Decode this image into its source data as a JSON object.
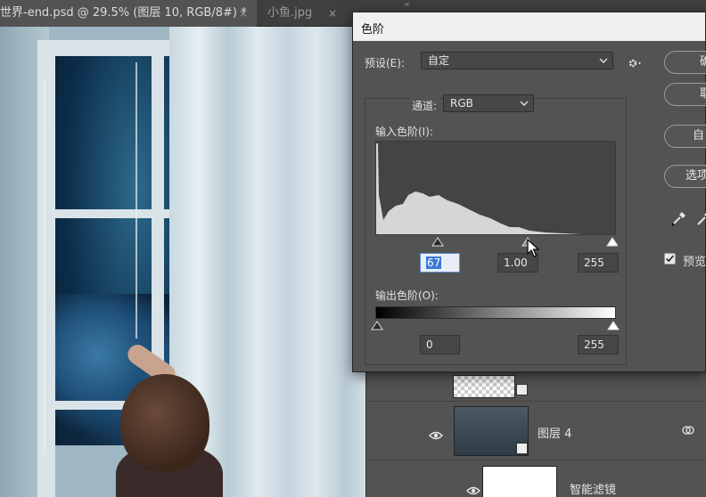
{
  "tabs": {
    "active_title": "世界-end.psd @ 29.5% (图层 10, RGB/8#) *",
    "inactive_title": "小鱼.jpg",
    "close_glyph": "×",
    "collapse_glyph": "«"
  },
  "layers_panel": {
    "layers": [
      {
        "name": "图层 4",
        "visible": true
      },
      {
        "name": "智能滤镜",
        "visible": true
      }
    ]
  },
  "levels_dialog": {
    "title": "色阶",
    "preset_label": "预设(E):",
    "preset_value": "自定",
    "channel_label": "通道:",
    "channel_value": "RGB",
    "input_levels_label": "输入色阶(I):",
    "input_black": "67",
    "input_gamma": "1.00",
    "input_white": "255",
    "output_levels_label": "输出色阶(O):",
    "output_black": "0",
    "output_white": "255",
    "buttons": {
      "ok_label": "确",
      "cancel_label": "取",
      "auto_label": "自",
      "options_label": "选项"
    },
    "preview_label": "预览",
    "preview_checked": true
  },
  "colors": {
    "panel_bg": "#535353",
    "titlebar_bg": "#f0f0f0",
    "field_highlight": "#3b78d8"
  }
}
